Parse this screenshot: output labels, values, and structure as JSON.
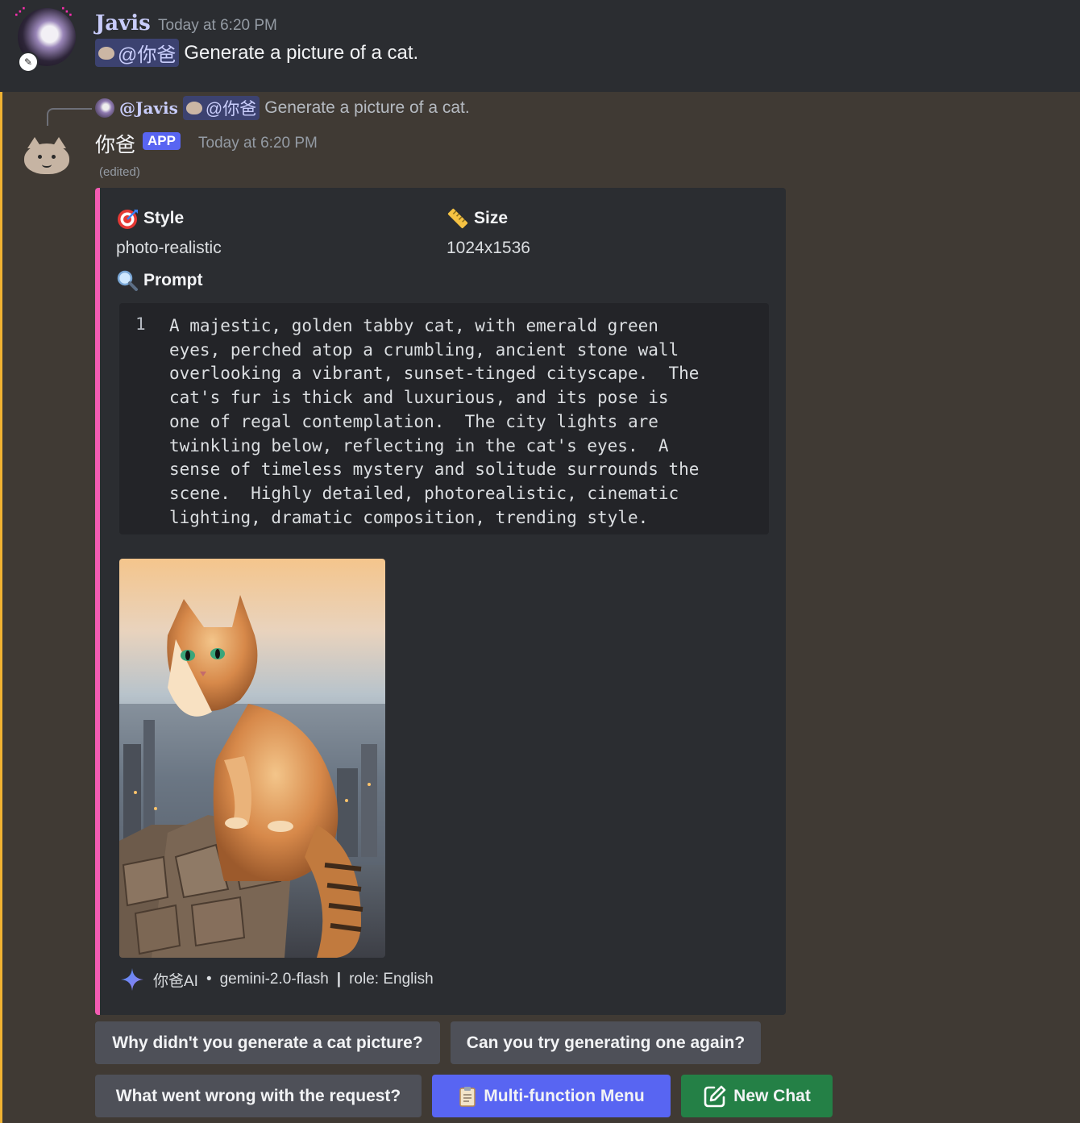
{
  "message1": {
    "author": "Javis",
    "timestamp": "Today at 6:20 PM",
    "mention": "@你爸",
    "text": "Generate a picture of a cat."
  },
  "message2": {
    "reply": {
      "author": "@Javis",
      "mention": "@你爸",
      "text": "Generate a picture of a cat."
    },
    "author": "你爸",
    "badge": "APP",
    "timestamp": "Today at 6:20 PM",
    "edited": "(edited)",
    "embed": {
      "accent_color": "#f35bb2",
      "style_title": "Style",
      "style_value": "photo-realistic",
      "size_title": "Size",
      "size_value": "1024x1536",
      "prompt_title": "Prompt",
      "code_line_number": "1",
      "prompt_text": "A majestic, golden tabby cat, with emerald green\neyes, perched atop a crumbling, ancient stone wall\noverlooking a vibrant, sunset-tinged cityscape.  The\ncat's fur is thick and luxurious, and its pose is\none of regal contemplation.  The city lights are\ntwinkling below, reflecting in the cat's eyes.  A\nsense of timeless mystery and solitude surrounds the\nscene.  Highly detailed, photorealistic, cinematic\nlighting, dramatic composition, trending style.",
      "footer_name": "你爸AI",
      "footer_separator": "•",
      "footer_model": "gemini-2.0-flash",
      "footer_divider": "|",
      "footer_role": "role: English"
    },
    "buttons": {
      "why": "Why didn't you generate a cat picture?",
      "again": "Can you try generating one again?",
      "wrong": "What went wrong with the request?",
      "menu": "Multi-function Menu",
      "new_chat": "New Chat"
    }
  },
  "colors": {
    "brand": "#5865f2",
    "success": "#248046",
    "secondary": "#4e5058",
    "highlight_bar": "#f0b232"
  },
  "icons": [
    "target-icon",
    "ruler-icon",
    "magnifier-icon",
    "sparkle-icon",
    "clipboard-icon",
    "edit-icon"
  ]
}
